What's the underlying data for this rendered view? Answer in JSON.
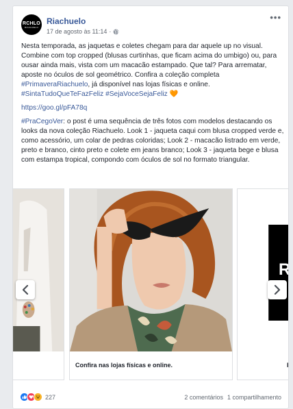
{
  "post": {
    "page_name": "Riachuelo",
    "logo_text": "RCHLO",
    "logo_sub": "RIACHUELO",
    "timestamp": "17 de agosto às 11:14",
    "dot": "·",
    "more": "•••",
    "paragraph1_a": "Nesta temporada, as jaquetas e coletes chegam para dar aquele up no visual. Combine com top cropped (blusas curtinhas, que ficam acima do umbigo) ou, para ousar ainda mais, vista com um macacão estampado. Que tal? Para arrematar, aposte no óculos de sol geométrico. Confira a coleção completa ",
    "hashtag1": "#PrimaveraRiachuelo",
    "paragraph1_b": ", já disponível nas lojas físicas e online. ",
    "hashtag2": "#SintaTudoQueTeFazFeliz",
    "hashtag3": "#SejaVoceSejaFeliz",
    "heart": "🧡",
    "link": "https://goo.gl/pFA78q",
    "hashtag4": "#PraCegoVer",
    "paragraph2": ": o post é uma sequência de três fotos com modelos destacando os looks da nova coleção Riachuelo. Look 1 - jaqueta caqui com blusa cropped verde e, como acessório, um colar de pedras coloridas; Look 2 - macacão listrado em verde, preto e branco, cinto preto e colete em jeans branco; Look 3 - jaqueta bege e blusa com estampa tropical, compondo com óculos de sol no formato triangular."
  },
  "carousel": {
    "main_caption": "Confira nas lojas físicas e online.",
    "right_caption": "R",
    "right_logo": "R"
  },
  "footer": {
    "reaction_count": "227",
    "comments": "2 comentários",
    "shares": "1 compartilhamento"
  },
  "colors": {
    "link_blue": "#385898",
    "like_blue": "#1877f2",
    "love_red": "#f33e58",
    "haha_yellow": "#f7b125"
  }
}
